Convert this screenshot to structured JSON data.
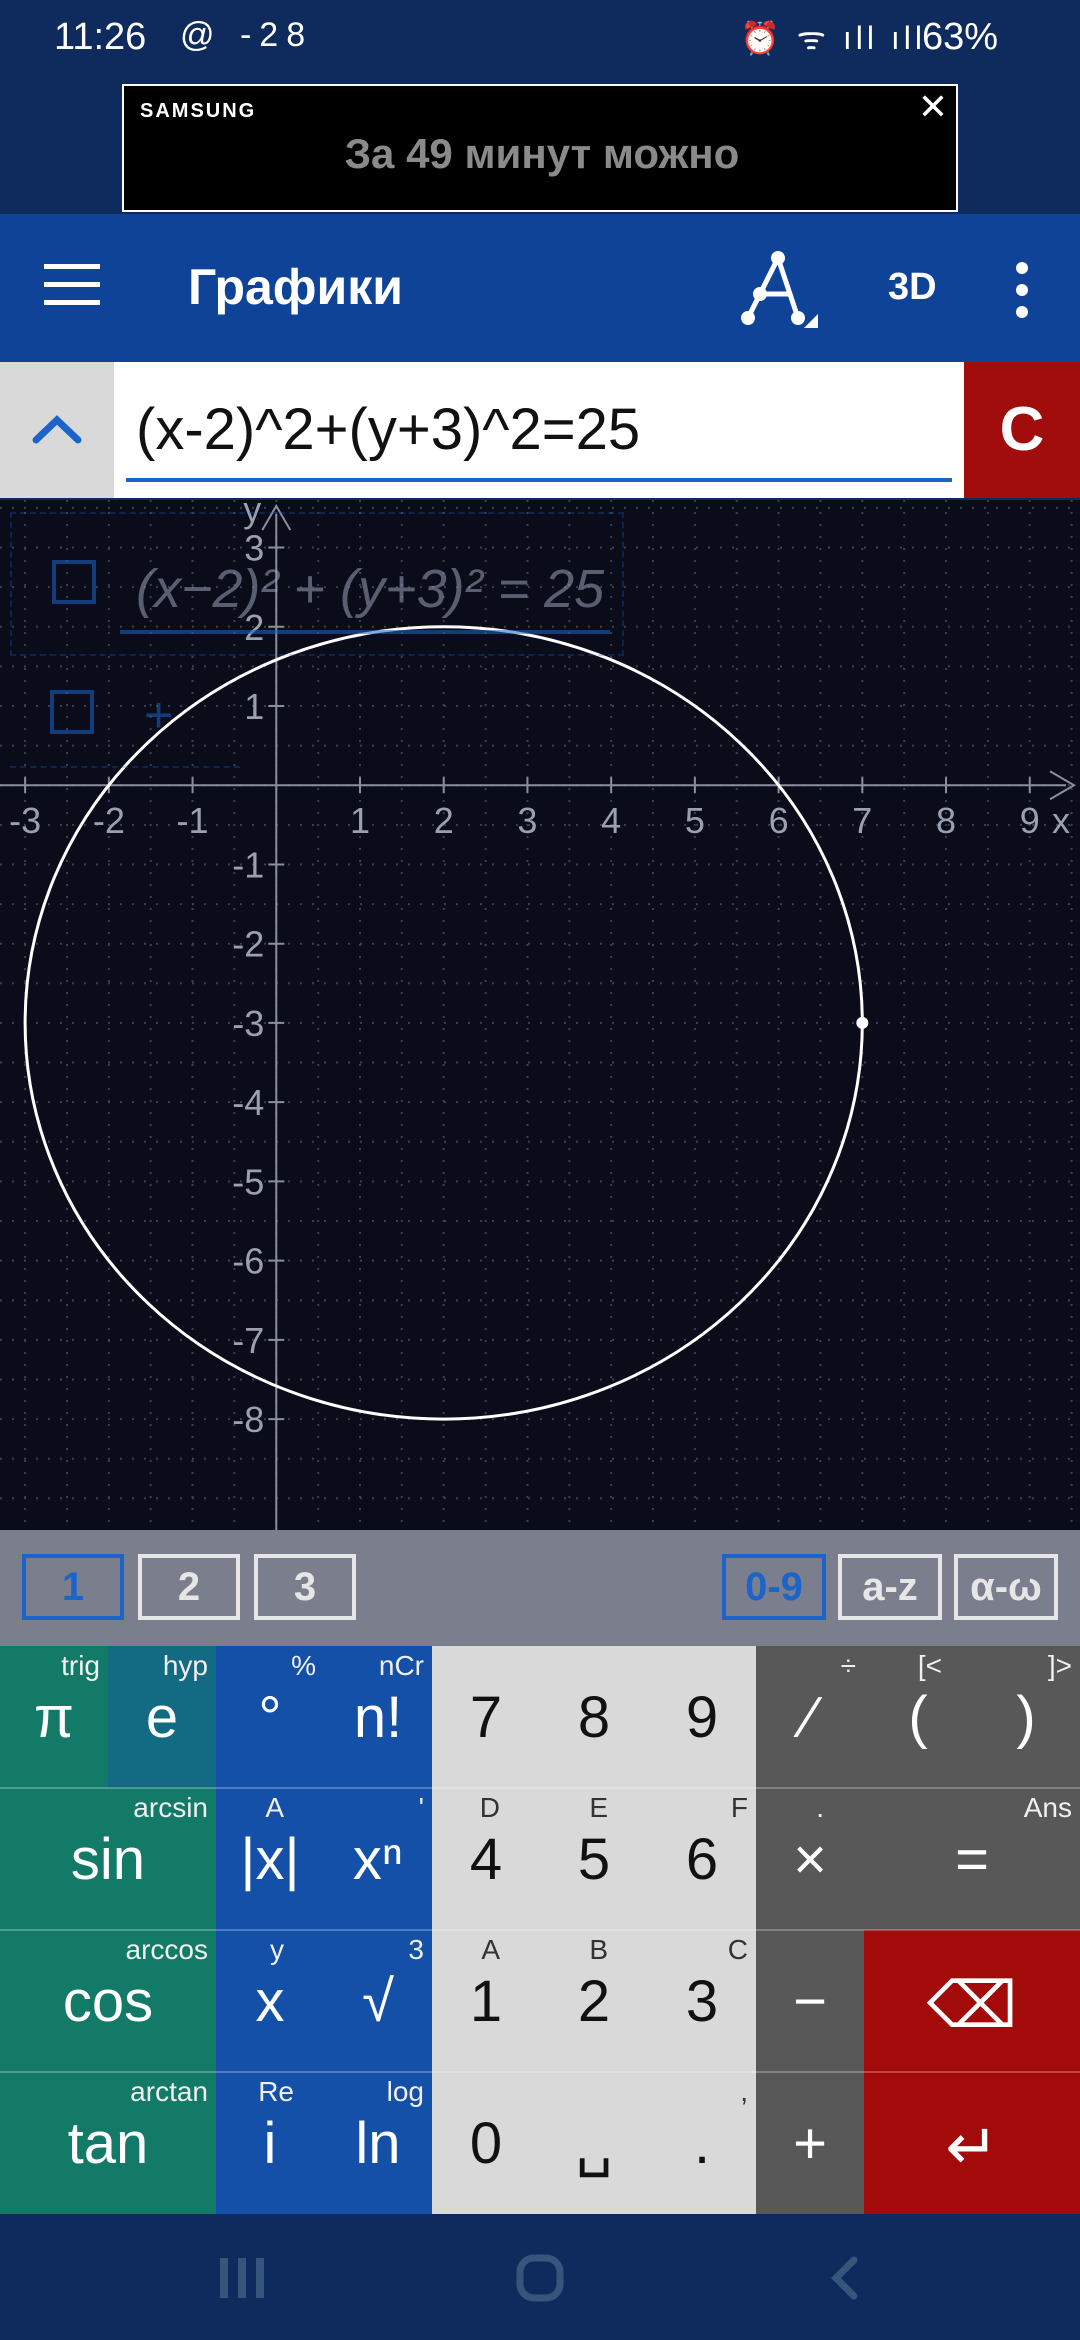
{
  "status_bar": {
    "time": "11:26",
    "left_icons": "@ -28",
    "battery_percent": "63%"
  },
  "ad": {
    "brand": "SAMSUNG",
    "text": "За 49 минут можно",
    "close_label": "✕"
  },
  "app_bar": {
    "title": "Графики",
    "mode_3d_label": "3D"
  },
  "input": {
    "expression": "(x-2)^2+(y+3)^2=25",
    "clear_label": "C"
  },
  "graph": {
    "overlay_expression": "(x−2)² + (y+3)² = 25",
    "overlay_add_label": "+",
    "x_axis_label": "x",
    "y_axis_label": "y",
    "x_ticks": [
      "-3",
      "-2",
      "-1",
      "1",
      "2",
      "3",
      "4",
      "5",
      "6",
      "7",
      "8",
      "9"
    ],
    "y_ticks": [
      "3",
      "2",
      "1",
      "-1",
      "-2",
      "-3",
      "-4",
      "-5",
      "-6",
      "-7",
      "-8"
    ],
    "circle": {
      "center_x": 2,
      "center_y": -3,
      "radius": 5
    },
    "x_range": [
      -3.3,
      9.6
    ],
    "y_range": [
      -9.4,
      3.6
    ]
  },
  "keyboard_tabs": {
    "left": [
      "1",
      "2",
      "3"
    ],
    "right": [
      "0-9",
      "a-z",
      "α-ω"
    ],
    "active_left": "1",
    "active_right": "0-9"
  },
  "keys": {
    "row1": [
      {
        "main": "π",
        "sup": "trig"
      },
      {
        "main": "e",
        "sup": "hyp"
      },
      {
        "main": "°",
        "sup": "%"
      },
      {
        "main": "n!",
        "sup": "nCr"
      },
      {
        "main": "7",
        "sup": ""
      },
      {
        "main": "8",
        "sup": ""
      },
      {
        "main": "9",
        "sup": ""
      },
      {
        "main": "∕",
        "sup": "÷"
      },
      {
        "main": "(",
        "sup": "[<"
      },
      {
        "main": ")",
        "sup": "]>"
      }
    ],
    "row2": [
      {
        "main": "sin",
        "sup": "arcsin"
      },
      {
        "main": "|x|",
        "sup": "A"
      },
      {
        "main": "xⁿ",
        "sup": "'"
      },
      {
        "main": "4",
        "sup": "D"
      },
      {
        "main": "5",
        "sup": "E"
      },
      {
        "main": "6",
        "sup": "F"
      },
      {
        "main": "×",
        "sup": "."
      },
      {
        "main": "=",
        "sup": "Ans"
      }
    ],
    "row3": [
      {
        "main": "cos",
        "sup": "arccos"
      },
      {
        "main": "x",
        "sup": "y"
      },
      {
        "main": "√",
        "sup": "3"
      },
      {
        "main": "1",
        "sup": "A"
      },
      {
        "main": "2",
        "sup": "B"
      },
      {
        "main": "3",
        "sup": "C"
      },
      {
        "main": "−",
        "sup": ""
      },
      {
        "main": "⌫",
        "sup": ""
      }
    ],
    "row4": [
      {
        "main": "tan",
        "sup": "arctan"
      },
      {
        "main": "i",
        "sup": "Re"
      },
      {
        "main": "ln",
        "sup": "log"
      },
      {
        "main": "0",
        "sup": ""
      },
      {
        "main": "␣",
        "sup": ""
      },
      {
        "main": ".",
        "sup": ","
      },
      {
        "main": "+",
        "sup": ""
      },
      {
        "main": "↵",
        "sup": ""
      }
    ]
  },
  "icons": {
    "menu": "hamburger-icon",
    "geometry": "geometry-tool-icon",
    "more": "more-vert-icon",
    "collapse": "chevron-up-icon",
    "recents": "recents-icon",
    "home": "home-icon",
    "back": "back-icon"
  },
  "colors": {
    "app_bar": "#0f4397",
    "clear_button": "#a10c0c",
    "graph_bg": "#0a0c1a",
    "accent_blue": "#1b64c9"
  }
}
